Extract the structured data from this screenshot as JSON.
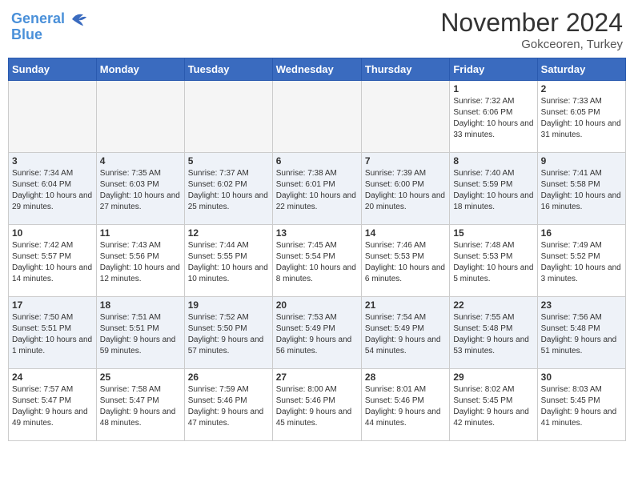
{
  "header": {
    "logo_line1": "General",
    "logo_line2": "Blue",
    "month": "November 2024",
    "location": "Gokceoren, Turkey"
  },
  "weekdays": [
    "Sunday",
    "Monday",
    "Tuesday",
    "Wednesday",
    "Thursday",
    "Friday",
    "Saturday"
  ],
  "weeks": [
    [
      {
        "day": "",
        "info": ""
      },
      {
        "day": "",
        "info": ""
      },
      {
        "day": "",
        "info": ""
      },
      {
        "day": "",
        "info": ""
      },
      {
        "day": "",
        "info": ""
      },
      {
        "day": "1",
        "info": "Sunrise: 7:32 AM\nSunset: 6:06 PM\nDaylight: 10 hours and 33 minutes."
      },
      {
        "day": "2",
        "info": "Sunrise: 7:33 AM\nSunset: 6:05 PM\nDaylight: 10 hours and 31 minutes."
      }
    ],
    [
      {
        "day": "3",
        "info": "Sunrise: 7:34 AM\nSunset: 6:04 PM\nDaylight: 10 hours and 29 minutes."
      },
      {
        "day": "4",
        "info": "Sunrise: 7:35 AM\nSunset: 6:03 PM\nDaylight: 10 hours and 27 minutes."
      },
      {
        "day": "5",
        "info": "Sunrise: 7:37 AM\nSunset: 6:02 PM\nDaylight: 10 hours and 25 minutes."
      },
      {
        "day": "6",
        "info": "Sunrise: 7:38 AM\nSunset: 6:01 PM\nDaylight: 10 hours and 22 minutes."
      },
      {
        "day": "7",
        "info": "Sunrise: 7:39 AM\nSunset: 6:00 PM\nDaylight: 10 hours and 20 minutes."
      },
      {
        "day": "8",
        "info": "Sunrise: 7:40 AM\nSunset: 5:59 PM\nDaylight: 10 hours and 18 minutes."
      },
      {
        "day": "9",
        "info": "Sunrise: 7:41 AM\nSunset: 5:58 PM\nDaylight: 10 hours and 16 minutes."
      }
    ],
    [
      {
        "day": "10",
        "info": "Sunrise: 7:42 AM\nSunset: 5:57 PM\nDaylight: 10 hours and 14 minutes."
      },
      {
        "day": "11",
        "info": "Sunrise: 7:43 AM\nSunset: 5:56 PM\nDaylight: 10 hours and 12 minutes."
      },
      {
        "day": "12",
        "info": "Sunrise: 7:44 AM\nSunset: 5:55 PM\nDaylight: 10 hours and 10 minutes."
      },
      {
        "day": "13",
        "info": "Sunrise: 7:45 AM\nSunset: 5:54 PM\nDaylight: 10 hours and 8 minutes."
      },
      {
        "day": "14",
        "info": "Sunrise: 7:46 AM\nSunset: 5:53 PM\nDaylight: 10 hours and 6 minutes."
      },
      {
        "day": "15",
        "info": "Sunrise: 7:48 AM\nSunset: 5:53 PM\nDaylight: 10 hours and 5 minutes."
      },
      {
        "day": "16",
        "info": "Sunrise: 7:49 AM\nSunset: 5:52 PM\nDaylight: 10 hours and 3 minutes."
      }
    ],
    [
      {
        "day": "17",
        "info": "Sunrise: 7:50 AM\nSunset: 5:51 PM\nDaylight: 10 hours and 1 minute."
      },
      {
        "day": "18",
        "info": "Sunrise: 7:51 AM\nSunset: 5:51 PM\nDaylight: 9 hours and 59 minutes."
      },
      {
        "day": "19",
        "info": "Sunrise: 7:52 AM\nSunset: 5:50 PM\nDaylight: 9 hours and 57 minutes."
      },
      {
        "day": "20",
        "info": "Sunrise: 7:53 AM\nSunset: 5:49 PM\nDaylight: 9 hours and 56 minutes."
      },
      {
        "day": "21",
        "info": "Sunrise: 7:54 AM\nSunset: 5:49 PM\nDaylight: 9 hours and 54 minutes."
      },
      {
        "day": "22",
        "info": "Sunrise: 7:55 AM\nSunset: 5:48 PM\nDaylight: 9 hours and 53 minutes."
      },
      {
        "day": "23",
        "info": "Sunrise: 7:56 AM\nSunset: 5:48 PM\nDaylight: 9 hours and 51 minutes."
      }
    ],
    [
      {
        "day": "24",
        "info": "Sunrise: 7:57 AM\nSunset: 5:47 PM\nDaylight: 9 hours and 49 minutes."
      },
      {
        "day": "25",
        "info": "Sunrise: 7:58 AM\nSunset: 5:47 PM\nDaylight: 9 hours and 48 minutes."
      },
      {
        "day": "26",
        "info": "Sunrise: 7:59 AM\nSunset: 5:46 PM\nDaylight: 9 hours and 47 minutes."
      },
      {
        "day": "27",
        "info": "Sunrise: 8:00 AM\nSunset: 5:46 PM\nDaylight: 9 hours and 45 minutes."
      },
      {
        "day": "28",
        "info": "Sunrise: 8:01 AM\nSunset: 5:46 PM\nDaylight: 9 hours and 44 minutes."
      },
      {
        "day": "29",
        "info": "Sunrise: 8:02 AM\nSunset: 5:45 PM\nDaylight: 9 hours and 42 minutes."
      },
      {
        "day": "30",
        "info": "Sunrise: 8:03 AM\nSunset: 5:45 PM\nDaylight: 9 hours and 41 minutes."
      }
    ]
  ]
}
